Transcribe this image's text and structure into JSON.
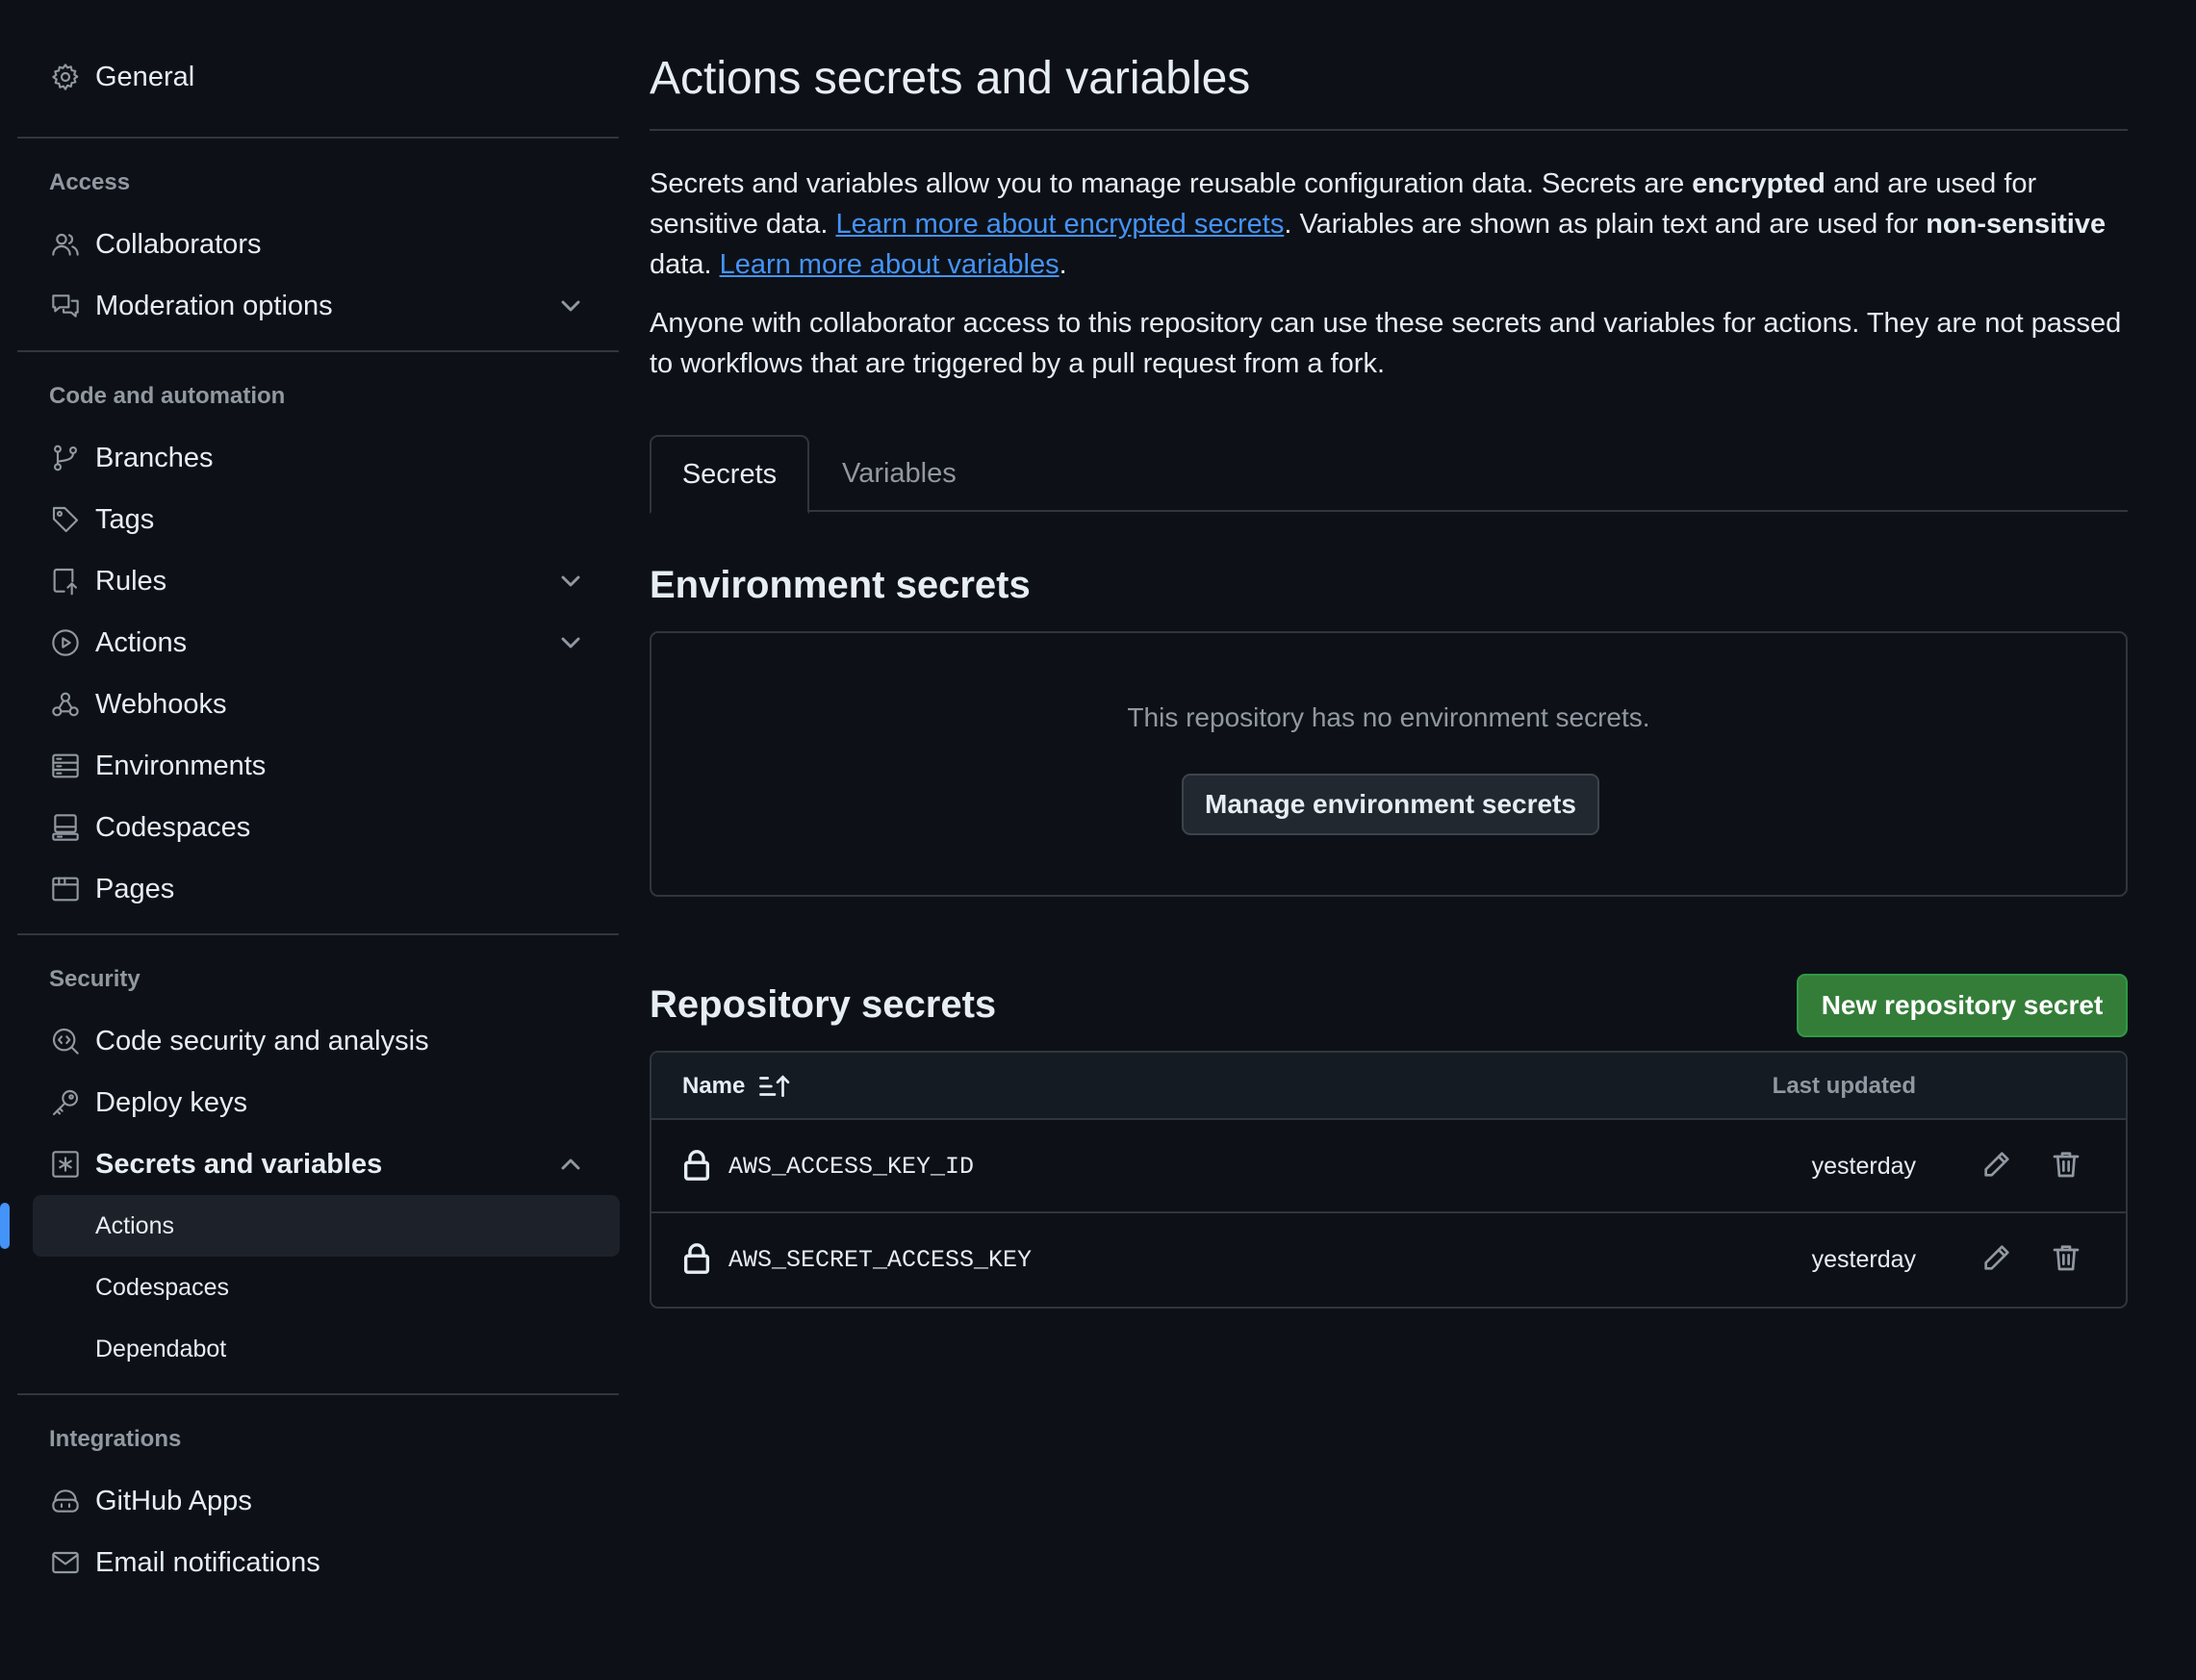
{
  "sidebar": {
    "general": "General",
    "sections": {
      "access": "Access",
      "code": "Code and automation",
      "security": "Security",
      "integrations": "Integrations"
    },
    "access_items": [
      "Collaborators",
      "Moderation options"
    ],
    "code_items": [
      "Branches",
      "Tags",
      "Rules",
      "Actions",
      "Webhooks",
      "Environments",
      "Codespaces",
      "Pages"
    ],
    "security_items": [
      "Code security and analysis",
      "Deploy keys",
      "Secrets and variables"
    ],
    "secrets_sub": [
      "Actions",
      "Codespaces",
      "Dependabot"
    ],
    "integration_items": [
      "GitHub Apps",
      "Email notifications"
    ],
    "active_sub": "Actions"
  },
  "main": {
    "title": "Actions secrets and variables",
    "intro": {
      "p1_a": "Secrets and variables allow you to manage reusable configuration data. Secrets are ",
      "p1_b": "encrypted",
      "p1_c": " and are used for sensitive data. ",
      "p1_link1": "Learn more about encrypted secrets",
      "p1_d": ". Variables are shown as plain text and are used for ",
      "p1_e": "non-sensitive",
      "p1_f": " data. ",
      "p1_link2": "Learn more about variables",
      "p1_g": ".",
      "p2": "Anyone with collaborator access to this repository can use these secrets and variables for actions. They are not passed to workflows that are triggered by a pull request from a fork."
    },
    "tabs": [
      "Secrets",
      "Variables"
    ],
    "env_title": "Environment secrets",
    "env_empty": "This repository has no environment secrets.",
    "env_button": "Manage environment secrets",
    "repo_title": "Repository secrets",
    "repo_button": "New repository secret",
    "table": {
      "col_name": "Name",
      "col_updated": "Last updated",
      "rows": [
        {
          "name": "AWS_ACCESS_KEY_ID",
          "updated": "yesterday"
        },
        {
          "name": "AWS_SECRET_ACCESS_KEY",
          "updated": "yesterday"
        }
      ]
    }
  },
  "colors": {
    "background": "#0d1117",
    "border": "#30363d",
    "link": "#4493f8",
    "primary_button": "#347d39",
    "muted_text": "#9198a1"
  }
}
